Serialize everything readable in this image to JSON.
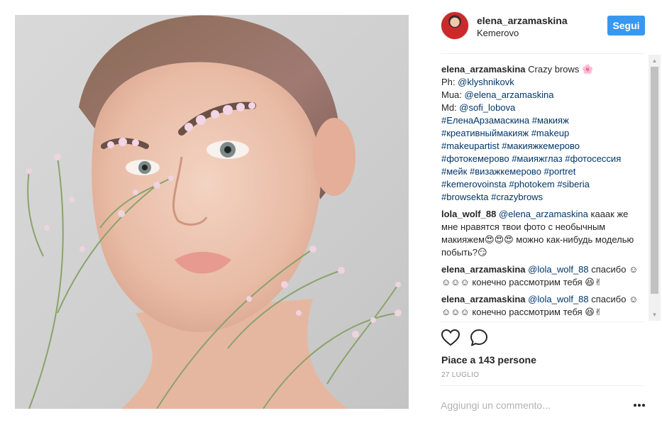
{
  "post": {
    "image_alt": "Model with flowers on eyebrows",
    "username": "elena_arzamaskina",
    "location": "Kemerovo",
    "follow_label": "Segui"
  },
  "caption": {
    "username": "elena_arzamaskina",
    "text": "Crazy brows 🌸",
    "lines": [
      {
        "prefix": "Ph: ",
        "mention": "@klyshnikovk"
      },
      {
        "prefix": "Mua: ",
        "mention": "@elena_arzamaskina"
      },
      {
        "prefix": "Md: ",
        "mention": "@sofi_lobova"
      }
    ],
    "hashtags": [
      "#ЕленаАрзамаскина #макияж",
      "#креативныймакияж #makeup",
      "#makeupartist #макияжкемерово",
      "#фотокемерово #маияжглаз #фотосессия",
      "#мейк #визажкемерово #portret",
      "#kemerovoinsta #photokem #siberia",
      "#browsekta #crazybrows"
    ]
  },
  "comments": [
    {
      "username": "lola_wolf_88",
      "mention": "@elena_arzamaskina",
      "text": "кааак же мне нравятся твои фото с необычным макияжем😍😍😍 можно как-нибудь моделью побыть?😏"
    },
    {
      "username": "elena_arzamaskina",
      "mention": "@lola_wolf_88",
      "text": "спасибо ☺☺☺☺ конечно рассмотрим тебя 😆✌"
    },
    {
      "username": "elena_arzamaskina",
      "mention": "@lola_wolf_88",
      "text": "спасибо ☺☺☺☺ конечно рассмотрим тебя 😆✌"
    }
  ],
  "actions": {
    "like_icon": "heart-icon",
    "comment_icon": "comment-bubble-icon"
  },
  "likes_text": "Piace a 143 persone",
  "date": "27 LUGLIO",
  "add_comment_placeholder": "Aggiungi un commento...",
  "more_label": "•••",
  "scrollbar": {
    "up": "▲",
    "down": "▼"
  }
}
